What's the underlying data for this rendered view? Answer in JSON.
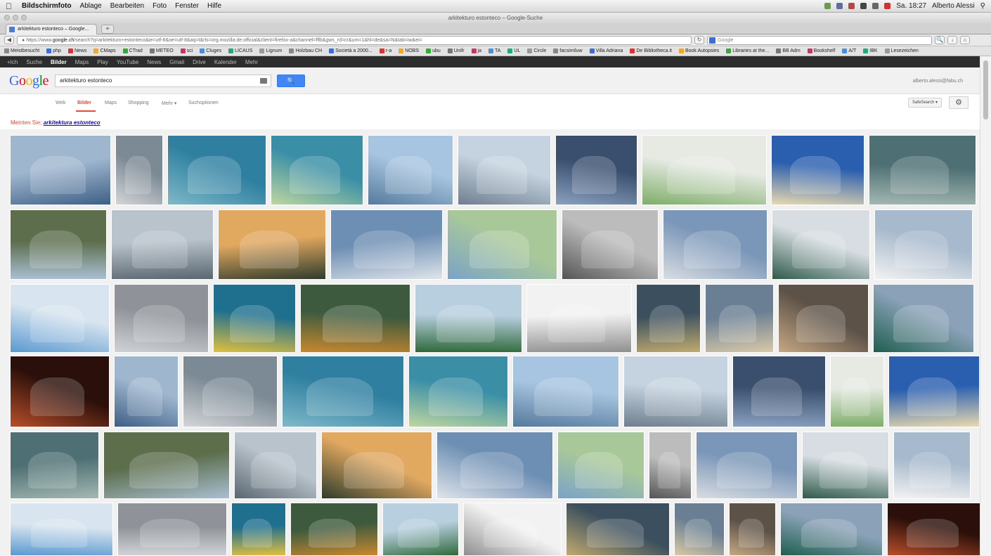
{
  "menubar": {
    "items": [
      "Bildschirmfoto",
      "Ablage",
      "Bearbeiten",
      "Foto",
      "Fenster",
      "Hilfe"
    ],
    "clock": "Sa. 18:27",
    "user": "Alberto Alessi"
  },
  "window": {
    "title": "arkitekturo estonteco – Google-Suche"
  },
  "tab": {
    "label": "arkitekturo estonteco – Google..."
  },
  "address": {
    "url_prefix": "https://www.",
    "url_host": "google.ch",
    "url_rest": "/search?q=arkitekturo+estonteco&ie=utf-8&oe=utf-8&aq=t&rls=org.mozilla:de:official&client=firefox-a&channel=fflb&gws_rd=cr&um=1&hl=de&sa=N&tab=iw&ei=",
    "search_placeholder": "Google"
  },
  "bookmarks": [
    "Meistbesucht",
    "php",
    "News",
    "CMaps",
    "CTrad",
    "METEO",
    "sci",
    "Cluges",
    "LICAUS",
    "Lignum",
    "Holzbau CH",
    "Società a 2000...",
    "r-a",
    "NOBS",
    "ubu",
    "Unifr",
    "ja",
    "TA",
    "UL",
    "Circle",
    "facsimiluw",
    "Villa Adriana",
    "De Bibliotheca.it",
    "Book Autopsies",
    "Libraries at the...",
    "BB Adm",
    "Bookshelf",
    "A/T",
    "IBK",
    "Lesezeichen"
  ],
  "gbar": [
    "+Ich",
    "Suche",
    "Bilder",
    "Maps",
    "Play",
    "YouTube",
    "News",
    "Gmail",
    "Drive",
    "Kalender",
    "Mehr"
  ],
  "gbar_active": "Bilder",
  "search": {
    "query": "arkitekturo estonteco",
    "button": "🔍",
    "account": "alberto.alessi@fabu.ch"
  },
  "tabs": [
    "Web",
    "Bilder",
    "Maps",
    "Shopping",
    "Mehr",
    "Suchoptionen"
  ],
  "active_tab": "Bilder",
  "safesearch": "SafeSearch",
  "settings_icon": "gear-icon",
  "did_you_mean": {
    "prefix": "Meinten Sie:",
    "suggestion": "arkitektura estonteco"
  }
}
